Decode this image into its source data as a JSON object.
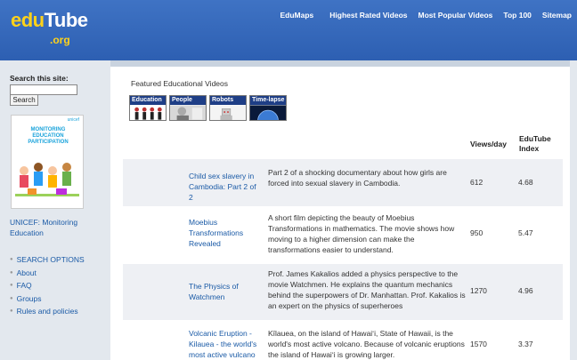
{
  "header": {
    "logo_main_1": "edu",
    "logo_main_2": "Tube",
    "logo_sub": ".org",
    "nav": [
      "EduMaps",
      "Highest Rated Videos",
      "Most Popular Videos",
      "Top 100",
      "Sitemap"
    ]
  },
  "sidebar": {
    "search_label": "Search this site:",
    "search_value": "",
    "search_button": "Search",
    "poster": {
      "brand": "unicef",
      "title": "MONITORING EDUCATION PARTICIPATION"
    },
    "unicef_link": "UNICEF: Monitoring Education",
    "menu": [
      "SEARCH OPTIONS",
      "About",
      "FAQ",
      "Groups",
      "Rules and policies"
    ]
  },
  "main": {
    "featured_label": "Featured Educational Videos",
    "categories": [
      "Education",
      "People",
      "Robots",
      "Time-lapse"
    ],
    "columns": {
      "views": "Views/day",
      "index": "EduTube Index"
    },
    "rows": [
      {
        "title": "Child sex slavery in Cambodia: Part 2 of 2",
        "description": "Part 2 of a shocking documentary about how girls are forced into sexual slavery in Cambodia.",
        "views": "612",
        "index": "4.68"
      },
      {
        "title": "Moebius Transformations Revealed",
        "description": "A short film depicting the beauty of Moebius Transformations in mathematics. The movie shows how moving to a higher dimension can make the transformations easier to understand.",
        "views": "950",
        "index": "5.47"
      },
      {
        "title": "The Physics of Watchmen",
        "description": "Prof. James Kakalios added a physics perspective to the movie Watchmen. He explains the quantum mechanics behind the superpowers of Dr. Manhattan. Prof. Kakalios is an expert on the physics of superheroes",
        "views": "1270",
        "index": "4.96"
      },
      {
        "title": "Volcanic Eruption - Kilauea - the world's most active vulcano",
        "description": "Kīlauea, on the island of Hawaiʻi, State of Hawaii, is the world's most active volcano. Because of volcanic eruptions the island of Hawaiʻi is growing larger.",
        "views": "1570",
        "index": "3.37"
      }
    ]
  },
  "colors": {
    "header_blue": "#2d5fb2",
    "logo_yellow": "#ffd21a",
    "link_blue": "#1a5aa6",
    "category_bar": "#1e3e86"
  }
}
